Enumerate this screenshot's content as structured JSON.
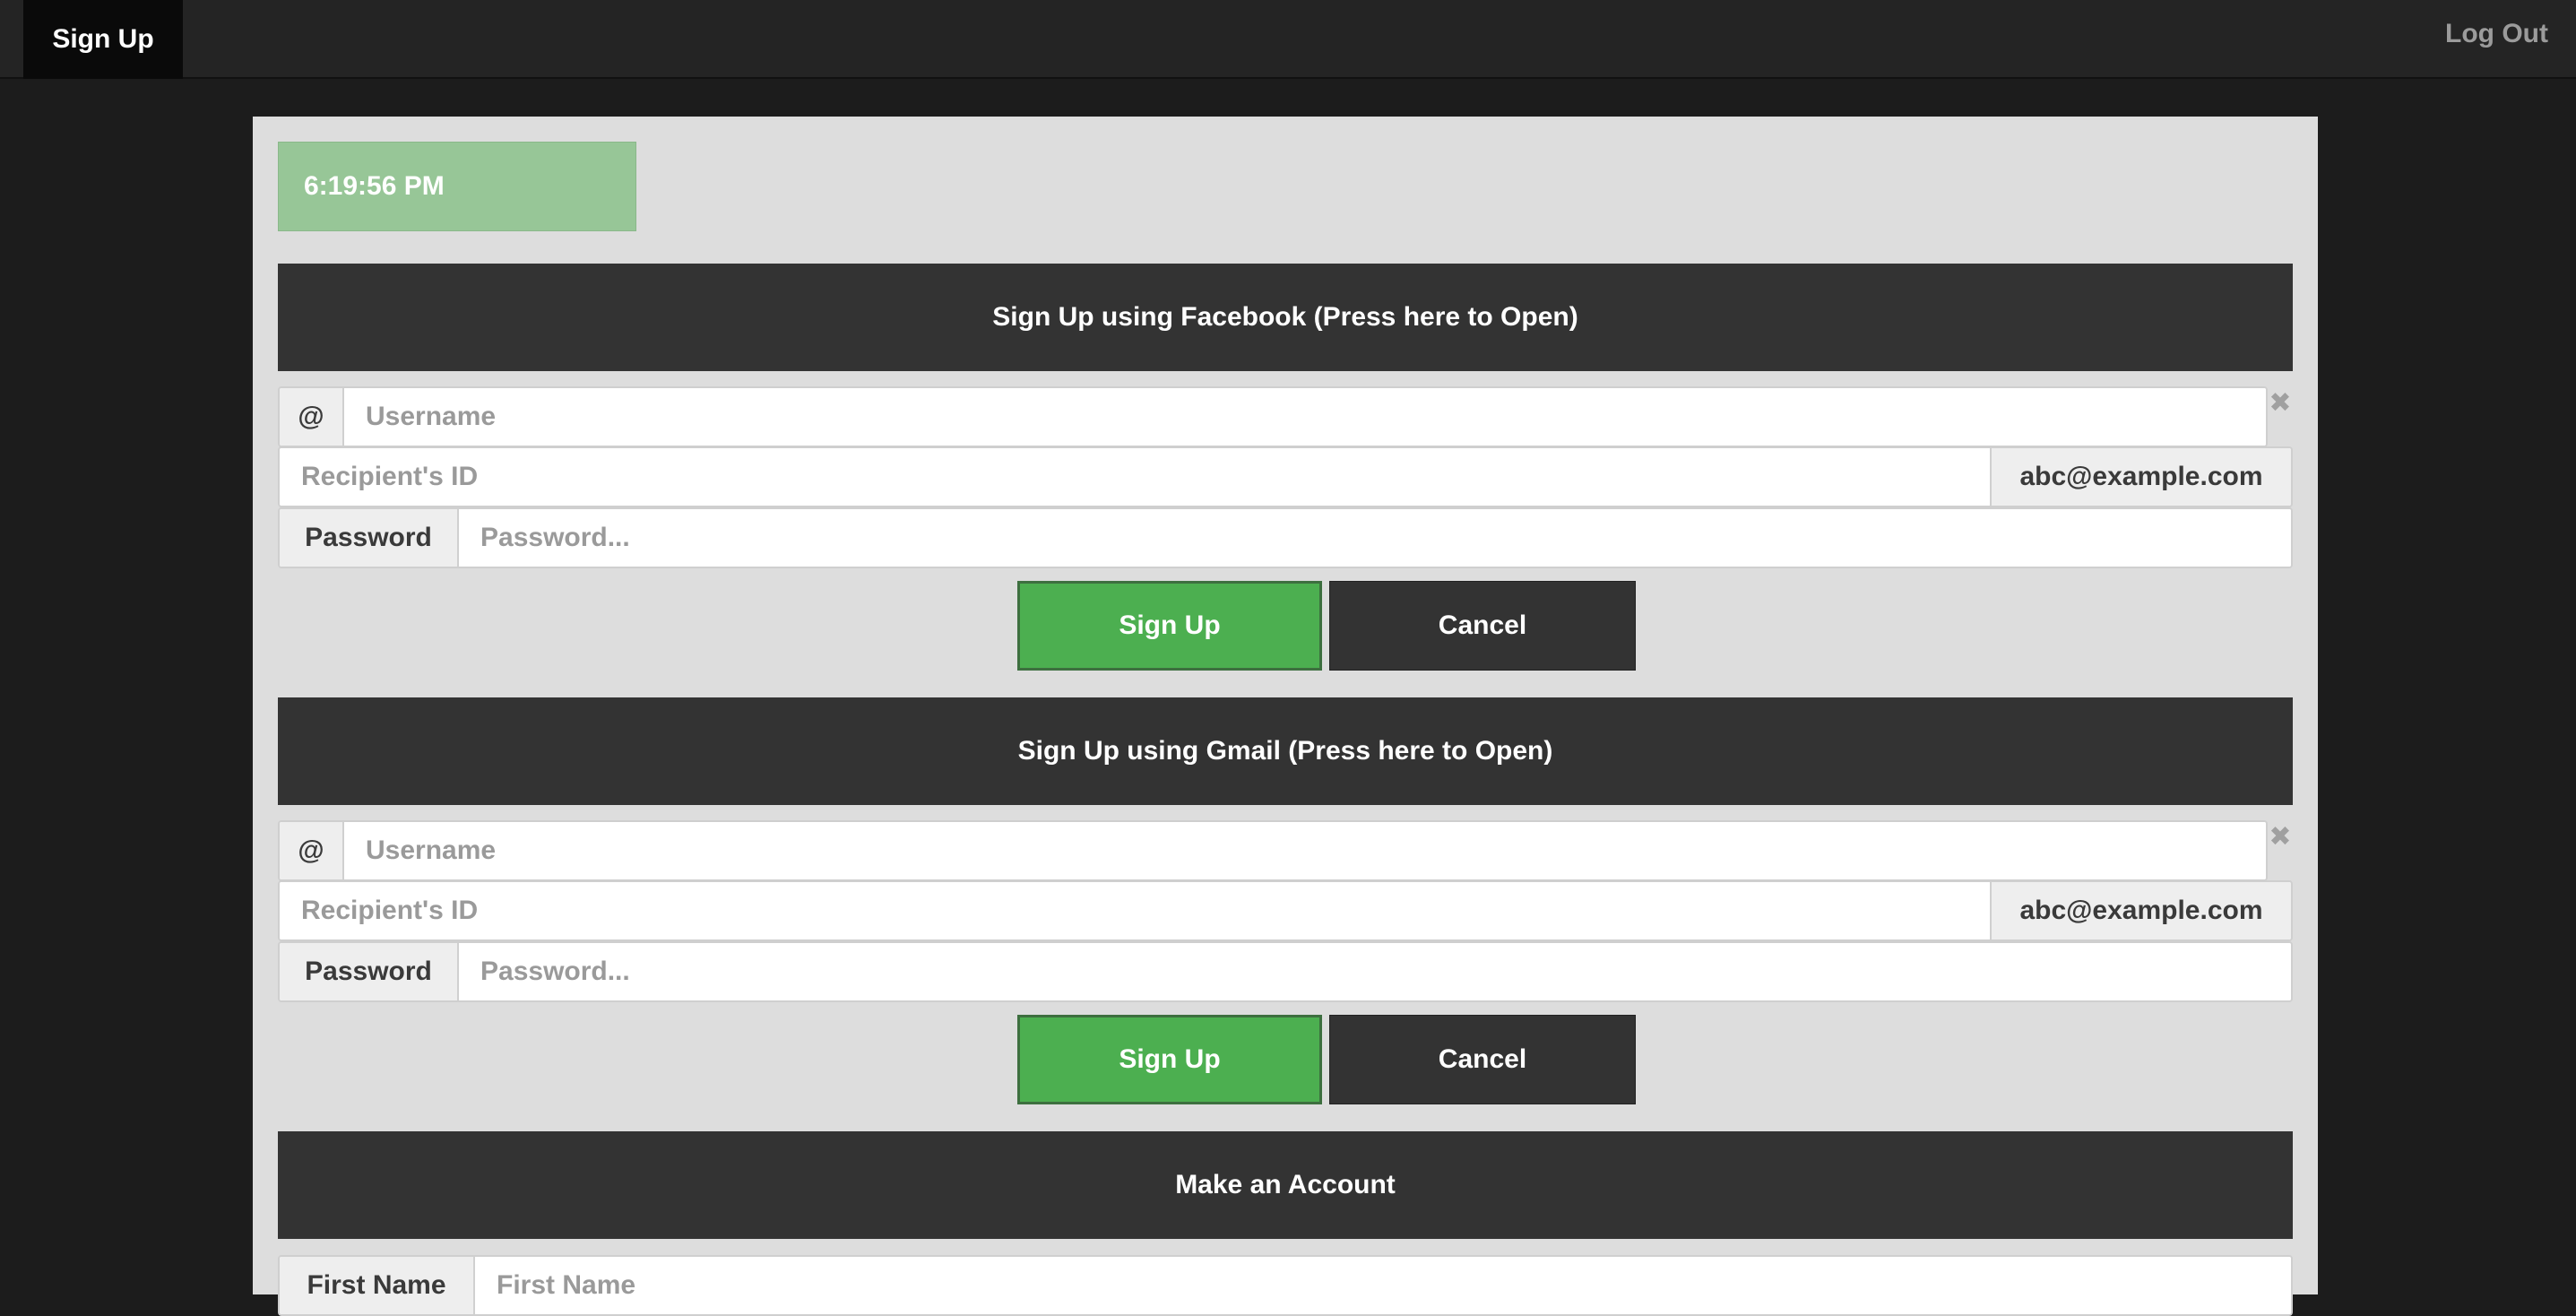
{
  "nav": {
    "active_tab": "Sign Up",
    "logout": "Log Out"
  },
  "clock": "6:19:56 PM",
  "facebook": {
    "header": "Sign Up using Facebook (Press here to Open)",
    "at_symbol": "@",
    "username_placeholder": "Username",
    "recipient_placeholder": "Recipient's ID",
    "email_suffix": "abc@example.com",
    "password_label": "Password",
    "password_placeholder": "Password...",
    "signup_label": "Sign Up",
    "cancel_label": "Cancel"
  },
  "gmail": {
    "header": "Sign Up using Gmail (Press here to Open)",
    "at_symbol": "@",
    "username_placeholder": "Username",
    "recipient_placeholder": "Recipient's ID",
    "email_suffix": "abc@example.com",
    "password_label": "Password",
    "password_placeholder": "Password...",
    "signup_label": "Sign Up",
    "cancel_label": "Cancel"
  },
  "account": {
    "header": "Make an Account",
    "first_name_label": "First Name",
    "first_name_placeholder": "First Name"
  },
  "icons": {
    "clear": "close-icon"
  },
  "colors": {
    "primary_button": "#4caf50",
    "clock_bg": "#97c697",
    "header_bg": "#333333"
  }
}
